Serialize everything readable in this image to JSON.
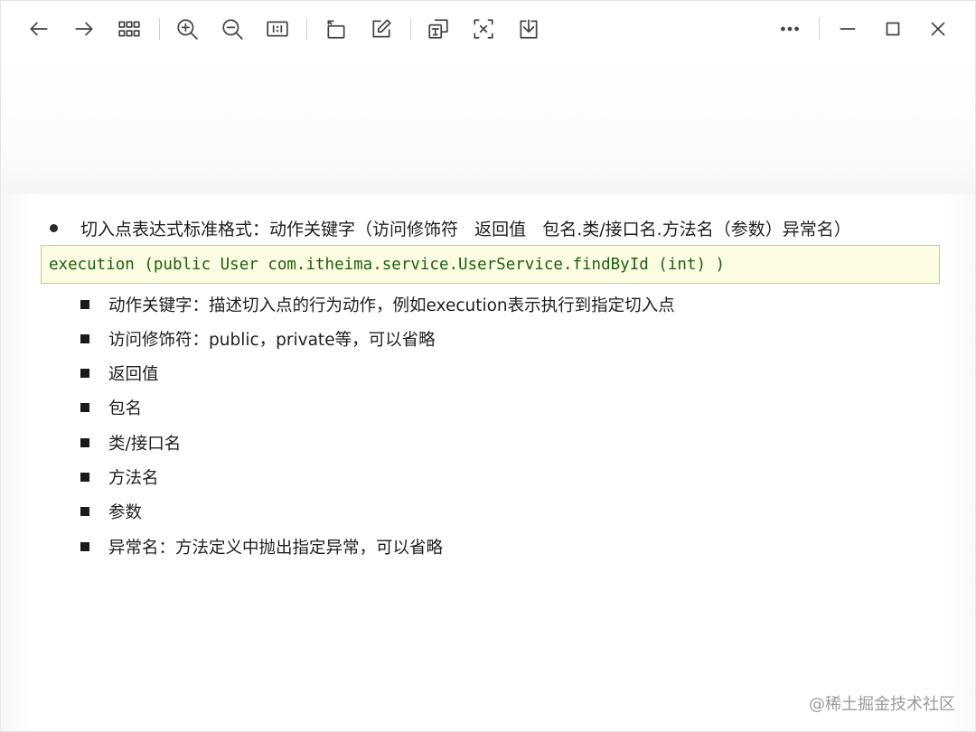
{
  "toolbar": {
    "buttons": [
      {
        "name": "back-arrow-icon"
      },
      {
        "name": "forward-arrow-icon"
      },
      {
        "name": "grid-view-icon"
      },
      {
        "name": "zoom-in-icon"
      },
      {
        "name": "zoom-out-icon"
      },
      {
        "name": "actual-size-icon",
        "label": "1:1"
      },
      {
        "name": "rotate-icon"
      },
      {
        "name": "edit-icon"
      },
      {
        "name": "translate-icon"
      },
      {
        "name": "text-extract-icon"
      },
      {
        "name": "download-icon"
      },
      {
        "name": "more-icon"
      },
      {
        "name": "minimize-icon"
      },
      {
        "name": "maximize-icon"
      },
      {
        "name": "close-icon"
      }
    ]
  },
  "slide": {
    "main_point": "切入点表达式标准格式：动作关键字（访问修饰符   返回值   包名.类/接口名.方法名（参数）异常名）",
    "code": "execution (public User com.itheima.service.UserService.findById (int) )",
    "items": [
      "动作关键字：描述切入点的行为动作，例如execution表示执行到指定切入点",
      "访问修饰符：public，private等，可以省略",
      "返回值",
      "包名",
      "类/接口名",
      "方法名",
      "参数",
      "异常名：方法定义中抛出指定异常，可以省略"
    ]
  },
  "watermark": "@稀土掘金技术社区",
  "colors": {
    "code_bg": "#fdfde3",
    "code_border": "#c9c98f",
    "code_text": "#1b5e10"
  }
}
